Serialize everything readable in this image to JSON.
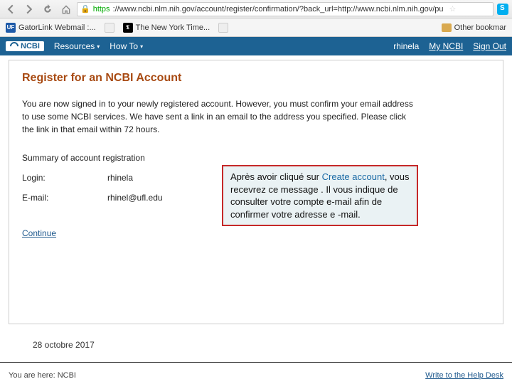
{
  "browser": {
    "url_secure_prefix": "https",
    "url_rest": "://www.ncbi.nlm.nih.gov/account/register/confirmation/?back_url=http://www.ncbi.nlm.nih.gov/pu"
  },
  "bookmarks": {
    "gator": "GatorLink Webmail :...",
    "nyt": "The New York Time...",
    "other": "Other bookmar"
  },
  "ncbi_nav": {
    "logo": "NCBI",
    "resources": "Resources",
    "howto": "How To",
    "user": "rhinela",
    "myncbi": "My NCBI",
    "signout": "Sign Out"
  },
  "page": {
    "title": "Register for an NCBI Account",
    "message": "You are now signed in to your newly registered account. However, you must confirm your email address to use some NCBI services. We have sent a link in an email to the address you specified. Please click the link in that email within 72 hours.",
    "summary_heading": "Summary of account registration",
    "login_label": "Login:",
    "login_value": "rhinela",
    "email_label": "E-mail:",
    "email_value": "rhinel@ufl.edu",
    "continue": "Continue"
  },
  "callout": {
    "p1a": "Après avoir cliqué sur ",
    "kw1": "Create",
    "kw2": "account",
    "p1b": ", vous recevrez ce message . Il vous indique de consulter votre compte e-mail afin de confirmer votre adresse e -mail."
  },
  "date": "28 octobre 2017",
  "footer": {
    "breadcrumb_label": "You are here: ",
    "breadcrumb_value": "NCBI",
    "help": "Write to the Help Desk"
  }
}
